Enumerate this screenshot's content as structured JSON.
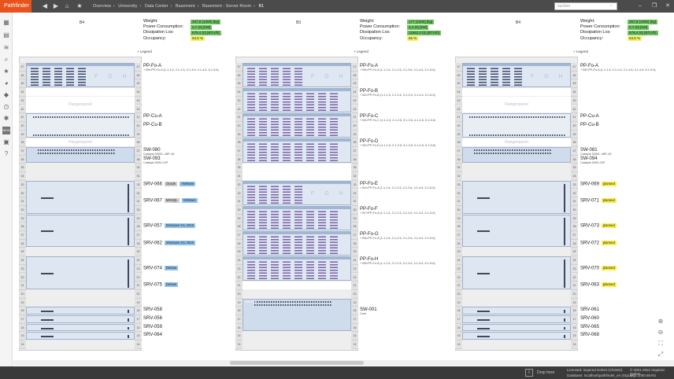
{
  "app": {
    "title": "Pathfinder"
  },
  "breadcrumb": [
    "Overview",
    "University",
    "Data Center",
    "Basement",
    "Basement - Server Room",
    "B1"
  ],
  "search": {
    "placeholder": "suchen"
  },
  "colors": {
    "brand": "#e8531d",
    "ok": "#6ec35a",
    "warn": "#f5f05a",
    "vm": "#8fc4ef",
    "planned": "#f9ee4c"
  },
  "icons": {
    "sidebar": [
      "overview-icon",
      "racks-icon",
      "cabling-icon",
      "search-icon",
      "favorites-icon",
      "reports-icon",
      "tags-icon",
      "history-icon",
      "network-icon",
      "new-badge-icon",
      "lock-icon",
      "help-icon"
    ]
  },
  "racks": [
    {
      "title": "B4",
      "stats": {
        "weight_label": "Weight:",
        "weight": "267,8 (1000) [kg]",
        "power_label": "Power Consumption:",
        "power": "2,7 (0) [kW]",
        "dissipation_label": "Dissipation Los:",
        "dissipation": "679,4 (0) [BTU/h]",
        "occupancy_label": "Occupancy:",
        "occupancy": "63,8 %"
      }
    },
    {
      "title": "B3",
      "stats": {
        "weight_label": "Weight:",
        "weight": "177 (1000) [kg]",
        "power_label": "Power Consumption:",
        "power": "3,4 (0) [kW]",
        "dissipation_label": "Dissipation Los:",
        "dissipation": "11662,3 (0) [BTU/h]",
        "occupancy_label": "Occupancy:",
        "occupancy": "66 %"
      }
    },
    {
      "title": "B4",
      "stats": {
        "weight_label": "Weight:",
        "weight": "267,8 (1000) [kg]",
        "power_label": "Power Consumption:",
        "power": "2,7 (0) [kW]",
        "dissipation_label": "Dissipation Los:",
        "dissipation": "679,4 (0) [BTU/h]",
        "occupancy_label": "Occupancy:",
        "occupancy": "63,8 %"
      }
    }
  ],
  "legend": "+ Legend",
  "rack_numbers": [
    "47",
    "46",
    "45",
    "44",
    "43",
    "42",
    "41",
    "40",
    "39",
    "38",
    "37",
    "36",
    "35",
    "34",
    "33",
    "32",
    "31",
    "30",
    "29",
    "28",
    "27",
    "26",
    "25",
    "24",
    "23",
    "22",
    "21",
    "20",
    "19",
    "18",
    "17",
    "16",
    "15",
    "14"
  ],
  "rangierpanel": "Rangierpanel",
  "fgh": [
    "F",
    "G",
    "H"
  ],
  "rack1_labels": {
    "ppfoa": "PP-Fo-A",
    "ppfoa_sub": "+ B5<PP-Fo-A (1.1-1.6, 2.1-2.6, 3.1-3.6, 4.1-4.6, 5.1-5.6)",
    "ppcua": "PP-Cu-A",
    "ppcub": "PP-Cu-B",
    "sw080": "SW-080",
    "sw080_sub": "Catalyst 9300L-48P-4G",
    "sw093": "SW-093",
    "sw093_sub": "Catalyst 9000-24P",
    "srv066": "SRV-066",
    "srv066_t1": "Oracle",
    "srv066_t2": "VMWare",
    "srv067": "SRV-067",
    "srv067_t1": "MSSQL",
    "srv067_t2": "VMWare",
    "srv057": "SRV-057",
    "srv057_t1": "Windows Srv 2019",
    "srv062": "SRV-062",
    "srv062_t1": "Windows Srv 2019",
    "srv074": "SRV-074",
    "srv074_t1": "Debian",
    "srv075": "SRV-075",
    "srv075_t1": "Debian",
    "srv058": "SRV-058",
    "srv056": "SRV-056",
    "srv059": "SRV-059",
    "srv064": "SRV-064"
  },
  "rack2_labels": {
    "ppfoa": "PP-Fo-A",
    "ppfoa_sub": "+ B5<PP-Fo-A (1.1-1.6, 2.1-2.6, 3.1-3.6, 4.1-4.6, 5.1-5.6)",
    "ppfob": "PP-Fo-B",
    "ppfob_sub": "+ B2<PP-Fo-B (1.1-1.6, 2.1-2.6, 3.1-3.6, 4.1-4.6, 5.1-5.6)",
    "ppfoc": "PP-Fo-C",
    "ppfoc_sub": "+ B2<PP-Fo-C (1.1-1.6, 2.1-2.6, 3.1-3.6, 4.1-4.6, 5.1-5.6)",
    "ppfod": "PP-Fo-D",
    "ppfod_sub": "+ B2<PP-Fo-D (1.1-1.6, 2.1-2.6, 3.1-3.6, 4.1-4.6, 5.1-5.6)",
    "ppfoe": "PP-Fo-E",
    "ppfoe_sub": "+ B4<PP-Fo-A (1.1-1.6, 2.1-2.6, 3.1-3.6, 4.1-4.6, 5.1-5.6)",
    "ppfof": "PP-Fo-F",
    "ppfof_sub": "+ B7<PP-Fo-A (1.1-1.6, 2.1-2.6, 3.1-3.6, 4.1-4.6, 5.1-5.6)",
    "ppfog": "PP-Fo-G",
    "ppfog_sub": "+ B6<PP-Fo-A (1.1-1.6, 2.1-2.6, 3.1-3.6, 4.1-4.6, 5.1-5.6)",
    "ppfoh": "PP-Fo-H",
    "ppfoh_sub": "+ B5<PP-Fo-A (1.1-1.6, 2.1-2.6, 3.1-3.6, 4.1-4.6, 5.1-5.6)",
    "sw001": "SW-001",
    "sw001_sub": "Core",
    "sw001_hdr": "SW-001"
  },
  "rack3_labels": {
    "ppfoa": "PP-Fo-A",
    "ppfoa_sub": "+ B5<PP-Fo-A (1.1-1.6, 2.1-2.6, 3.1-3.6, 4.1-4.6, 5.1-5.6)",
    "ppcua": "PP-Cu-A",
    "ppcub": "PP-Cu-B",
    "sw081": "SW-081",
    "sw081_sub": "Catalyst 9300L-48P-4G",
    "sw094": "SW-094",
    "sw094_sub": "Catalyst 9000-24P",
    "srv069": "SRV-069",
    "srv071": "SRV-071",
    "srv073": "SRV-073",
    "srv072": "SRV-072",
    "srv070": "SRV-070",
    "srv063": "SRV-063",
    "srv061": "SRV-061",
    "srv060": "SRV-060",
    "srv065": "SRV-065",
    "srv068": "SRV-068",
    "planned": "planned"
  },
  "footer": {
    "drop": "Drop here",
    "license": "Licensed: Inquired GmbH (Christin)",
    "db": "Database: localhost\\pathfinder_en (SQLite)",
    "copyright": "© 2001-2021 Inquired GmbH",
    "version": "v3.2.1000.58.R2"
  }
}
